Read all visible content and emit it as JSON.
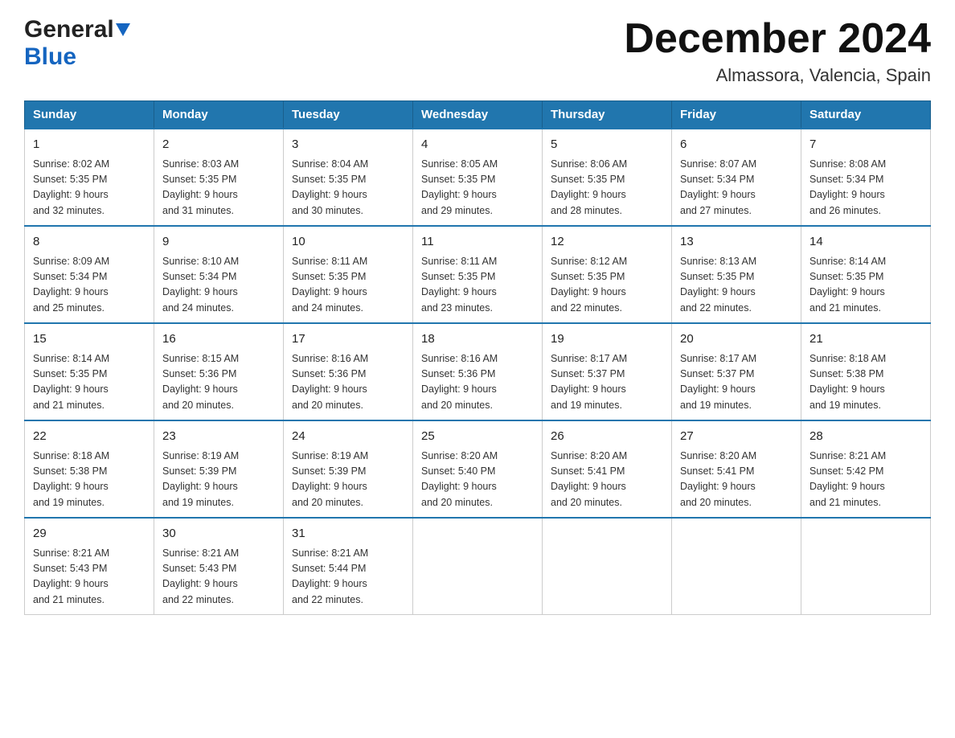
{
  "logo": {
    "general": "General",
    "blue": "Blue"
  },
  "title": "December 2024",
  "subtitle": "Almassora, Valencia, Spain",
  "days_of_week": [
    "Sunday",
    "Monday",
    "Tuesday",
    "Wednesday",
    "Thursday",
    "Friday",
    "Saturday"
  ],
  "weeks": [
    [
      {
        "day": "1",
        "sunrise": "Sunrise: 8:02 AM",
        "sunset": "Sunset: 5:35 PM",
        "daylight": "Daylight: 9 hours",
        "daylight2": "and 32 minutes."
      },
      {
        "day": "2",
        "sunrise": "Sunrise: 8:03 AM",
        "sunset": "Sunset: 5:35 PM",
        "daylight": "Daylight: 9 hours",
        "daylight2": "and 31 minutes."
      },
      {
        "day": "3",
        "sunrise": "Sunrise: 8:04 AM",
        "sunset": "Sunset: 5:35 PM",
        "daylight": "Daylight: 9 hours",
        "daylight2": "and 30 minutes."
      },
      {
        "day": "4",
        "sunrise": "Sunrise: 8:05 AM",
        "sunset": "Sunset: 5:35 PM",
        "daylight": "Daylight: 9 hours",
        "daylight2": "and 29 minutes."
      },
      {
        "day": "5",
        "sunrise": "Sunrise: 8:06 AM",
        "sunset": "Sunset: 5:35 PM",
        "daylight": "Daylight: 9 hours",
        "daylight2": "and 28 minutes."
      },
      {
        "day": "6",
        "sunrise": "Sunrise: 8:07 AM",
        "sunset": "Sunset: 5:34 PM",
        "daylight": "Daylight: 9 hours",
        "daylight2": "and 27 minutes."
      },
      {
        "day": "7",
        "sunrise": "Sunrise: 8:08 AM",
        "sunset": "Sunset: 5:34 PM",
        "daylight": "Daylight: 9 hours",
        "daylight2": "and 26 minutes."
      }
    ],
    [
      {
        "day": "8",
        "sunrise": "Sunrise: 8:09 AM",
        "sunset": "Sunset: 5:34 PM",
        "daylight": "Daylight: 9 hours",
        "daylight2": "and 25 minutes."
      },
      {
        "day": "9",
        "sunrise": "Sunrise: 8:10 AM",
        "sunset": "Sunset: 5:34 PM",
        "daylight": "Daylight: 9 hours",
        "daylight2": "and 24 minutes."
      },
      {
        "day": "10",
        "sunrise": "Sunrise: 8:11 AM",
        "sunset": "Sunset: 5:35 PM",
        "daylight": "Daylight: 9 hours",
        "daylight2": "and 24 minutes."
      },
      {
        "day": "11",
        "sunrise": "Sunrise: 8:11 AM",
        "sunset": "Sunset: 5:35 PM",
        "daylight": "Daylight: 9 hours",
        "daylight2": "and 23 minutes."
      },
      {
        "day": "12",
        "sunrise": "Sunrise: 8:12 AM",
        "sunset": "Sunset: 5:35 PM",
        "daylight": "Daylight: 9 hours",
        "daylight2": "and 22 minutes."
      },
      {
        "day": "13",
        "sunrise": "Sunrise: 8:13 AM",
        "sunset": "Sunset: 5:35 PM",
        "daylight": "Daylight: 9 hours",
        "daylight2": "and 22 minutes."
      },
      {
        "day": "14",
        "sunrise": "Sunrise: 8:14 AM",
        "sunset": "Sunset: 5:35 PM",
        "daylight": "Daylight: 9 hours",
        "daylight2": "and 21 minutes."
      }
    ],
    [
      {
        "day": "15",
        "sunrise": "Sunrise: 8:14 AM",
        "sunset": "Sunset: 5:35 PM",
        "daylight": "Daylight: 9 hours",
        "daylight2": "and 21 minutes."
      },
      {
        "day": "16",
        "sunrise": "Sunrise: 8:15 AM",
        "sunset": "Sunset: 5:36 PM",
        "daylight": "Daylight: 9 hours",
        "daylight2": "and 20 minutes."
      },
      {
        "day": "17",
        "sunrise": "Sunrise: 8:16 AM",
        "sunset": "Sunset: 5:36 PM",
        "daylight": "Daylight: 9 hours",
        "daylight2": "and 20 minutes."
      },
      {
        "day": "18",
        "sunrise": "Sunrise: 8:16 AM",
        "sunset": "Sunset: 5:36 PM",
        "daylight": "Daylight: 9 hours",
        "daylight2": "and 20 minutes."
      },
      {
        "day": "19",
        "sunrise": "Sunrise: 8:17 AM",
        "sunset": "Sunset: 5:37 PM",
        "daylight": "Daylight: 9 hours",
        "daylight2": "and 19 minutes."
      },
      {
        "day": "20",
        "sunrise": "Sunrise: 8:17 AM",
        "sunset": "Sunset: 5:37 PM",
        "daylight": "Daylight: 9 hours",
        "daylight2": "and 19 minutes."
      },
      {
        "day": "21",
        "sunrise": "Sunrise: 8:18 AM",
        "sunset": "Sunset: 5:38 PM",
        "daylight": "Daylight: 9 hours",
        "daylight2": "and 19 minutes."
      }
    ],
    [
      {
        "day": "22",
        "sunrise": "Sunrise: 8:18 AM",
        "sunset": "Sunset: 5:38 PM",
        "daylight": "Daylight: 9 hours",
        "daylight2": "and 19 minutes."
      },
      {
        "day": "23",
        "sunrise": "Sunrise: 8:19 AM",
        "sunset": "Sunset: 5:39 PM",
        "daylight": "Daylight: 9 hours",
        "daylight2": "and 19 minutes."
      },
      {
        "day": "24",
        "sunrise": "Sunrise: 8:19 AM",
        "sunset": "Sunset: 5:39 PM",
        "daylight": "Daylight: 9 hours",
        "daylight2": "and 20 minutes."
      },
      {
        "day": "25",
        "sunrise": "Sunrise: 8:20 AM",
        "sunset": "Sunset: 5:40 PM",
        "daylight": "Daylight: 9 hours",
        "daylight2": "and 20 minutes."
      },
      {
        "day": "26",
        "sunrise": "Sunrise: 8:20 AM",
        "sunset": "Sunset: 5:41 PM",
        "daylight": "Daylight: 9 hours",
        "daylight2": "and 20 minutes."
      },
      {
        "day": "27",
        "sunrise": "Sunrise: 8:20 AM",
        "sunset": "Sunset: 5:41 PM",
        "daylight": "Daylight: 9 hours",
        "daylight2": "and 20 minutes."
      },
      {
        "day": "28",
        "sunrise": "Sunrise: 8:21 AM",
        "sunset": "Sunset: 5:42 PM",
        "daylight": "Daylight: 9 hours",
        "daylight2": "and 21 minutes."
      }
    ],
    [
      {
        "day": "29",
        "sunrise": "Sunrise: 8:21 AM",
        "sunset": "Sunset: 5:43 PM",
        "daylight": "Daylight: 9 hours",
        "daylight2": "and 21 minutes."
      },
      {
        "day": "30",
        "sunrise": "Sunrise: 8:21 AM",
        "sunset": "Sunset: 5:43 PM",
        "daylight": "Daylight: 9 hours",
        "daylight2": "and 22 minutes."
      },
      {
        "day": "31",
        "sunrise": "Sunrise: 8:21 AM",
        "sunset": "Sunset: 5:44 PM",
        "daylight": "Daylight: 9 hours",
        "daylight2": "and 22 minutes."
      },
      null,
      null,
      null,
      null
    ]
  ]
}
